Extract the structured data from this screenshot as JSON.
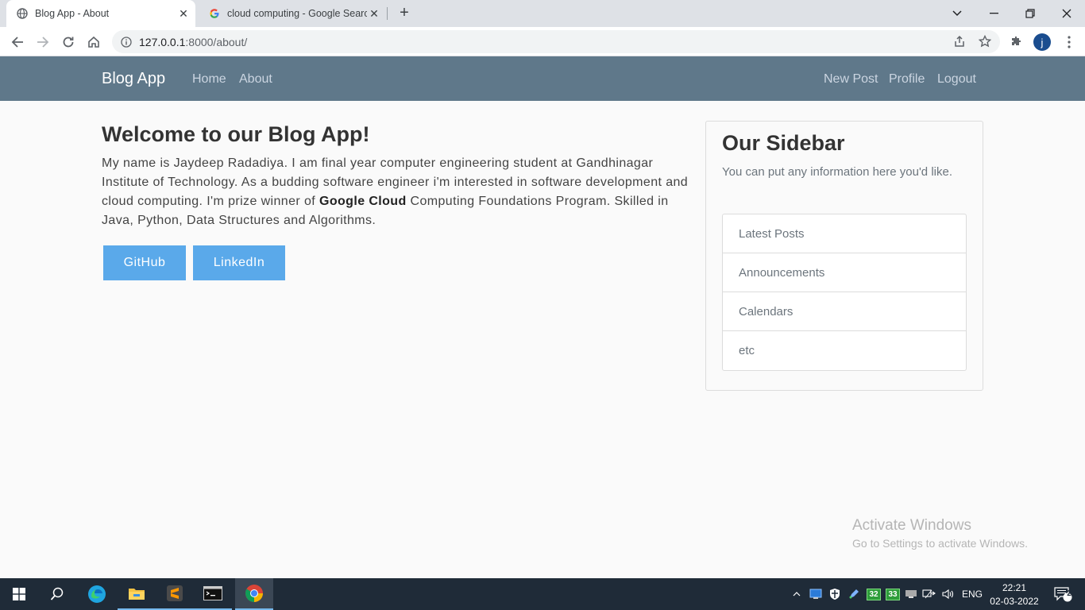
{
  "browser": {
    "tabs": [
      {
        "title": "Blog App - About",
        "active": true
      },
      {
        "title": "cloud computing - Google Search",
        "active": false
      }
    ],
    "url_host": "127.0.0.1",
    "url_path": ":8000/about/",
    "profile_initial": "j"
  },
  "navbar": {
    "brand": "Blog App",
    "left_links": [
      "Home",
      "About"
    ],
    "right_links": [
      "New Post",
      "Profile",
      "Logout"
    ]
  },
  "main": {
    "title": "Welcome to our Blog App!",
    "text_before": "My name is Jaydeep Radadiya. I am final year computer engineering student at Gandhinagar Institute of Technology. As a budding software engineer i'm interested in software development and cloud computing. I'm prize winner of ",
    "text_bold": "Google Cloud",
    "text_after": " Computing Foundations Program. Skilled in Java, Python, Data Structures and Algorithms.",
    "buttons": [
      "GitHub",
      "LinkedIn"
    ],
    "button_color": "#5aa9ea"
  },
  "sidebar": {
    "title": "Our Sidebar",
    "text": "You can put any information here you'd like.",
    "items": [
      "Latest Posts",
      "Announcements",
      "Calendars",
      "etc"
    ]
  },
  "watermark": {
    "line1": "Activate Windows",
    "line2": "Go to Settings to activate Windows."
  },
  "taskbar": {
    "language": "ENG",
    "time": "22:21",
    "date": "02-03-2022",
    "notifications": "2",
    "tray_badges": [
      "32",
      "33"
    ]
  }
}
